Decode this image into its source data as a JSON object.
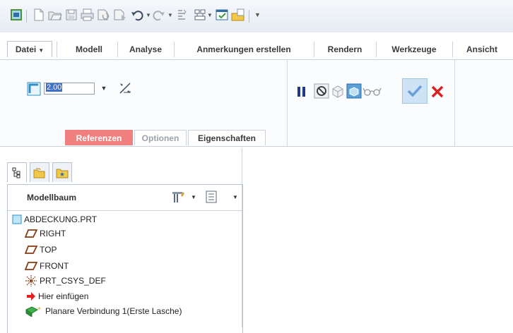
{
  "quick_access": {
    "icons": [
      "model-window-icon",
      "new-icon",
      "open-icon",
      "save-icon",
      "print-icon",
      "regenerate-icon",
      "regenerate-manager-icon",
      "undo-icon",
      "redo-icon",
      "attach-icon",
      "layer-icon",
      "windows-icon",
      "close-window-icon",
      "customize-icon"
    ]
  },
  "tabs": [
    "Datei",
    "Modell",
    "Analyse",
    "Anmerkungen erstellen",
    "Rendern",
    "Werkzeuge",
    "Ansicht"
  ],
  "dashboard": {
    "thickness_value": "2.00",
    "subtabs": [
      "Referenzen",
      "Optionen",
      "Eigenschaften"
    ],
    "colors": {
      "referenzen_bg": "#f07f7f",
      "apply_check": "#6a9fd8",
      "cancel_x": "#d9201f",
      "pause": "#1e3b8a"
    }
  },
  "navigator": {
    "tab_icons": [
      "model-tree-icon",
      "folder-browser-icon",
      "favorites-icon"
    ],
    "title": "Modellbaum",
    "items": [
      {
        "label": "ABDECKUNG.PRT",
        "icon": "part-icon"
      },
      {
        "label": "RIGHT",
        "icon": "datum-plane-icon"
      },
      {
        "label": "TOP",
        "icon": "datum-plane-icon"
      },
      {
        "label": "FRONT",
        "icon": "datum-plane-icon"
      },
      {
        "label": "PRT_CSYS_DEF",
        "icon": "csys-icon"
      },
      {
        "label": "Hier einfügen",
        "icon": "insert-arrow-icon"
      },
      {
        "label": "Planare Verbindung 1(Erste Lasche)",
        "icon": "planar-wall-icon"
      }
    ]
  }
}
